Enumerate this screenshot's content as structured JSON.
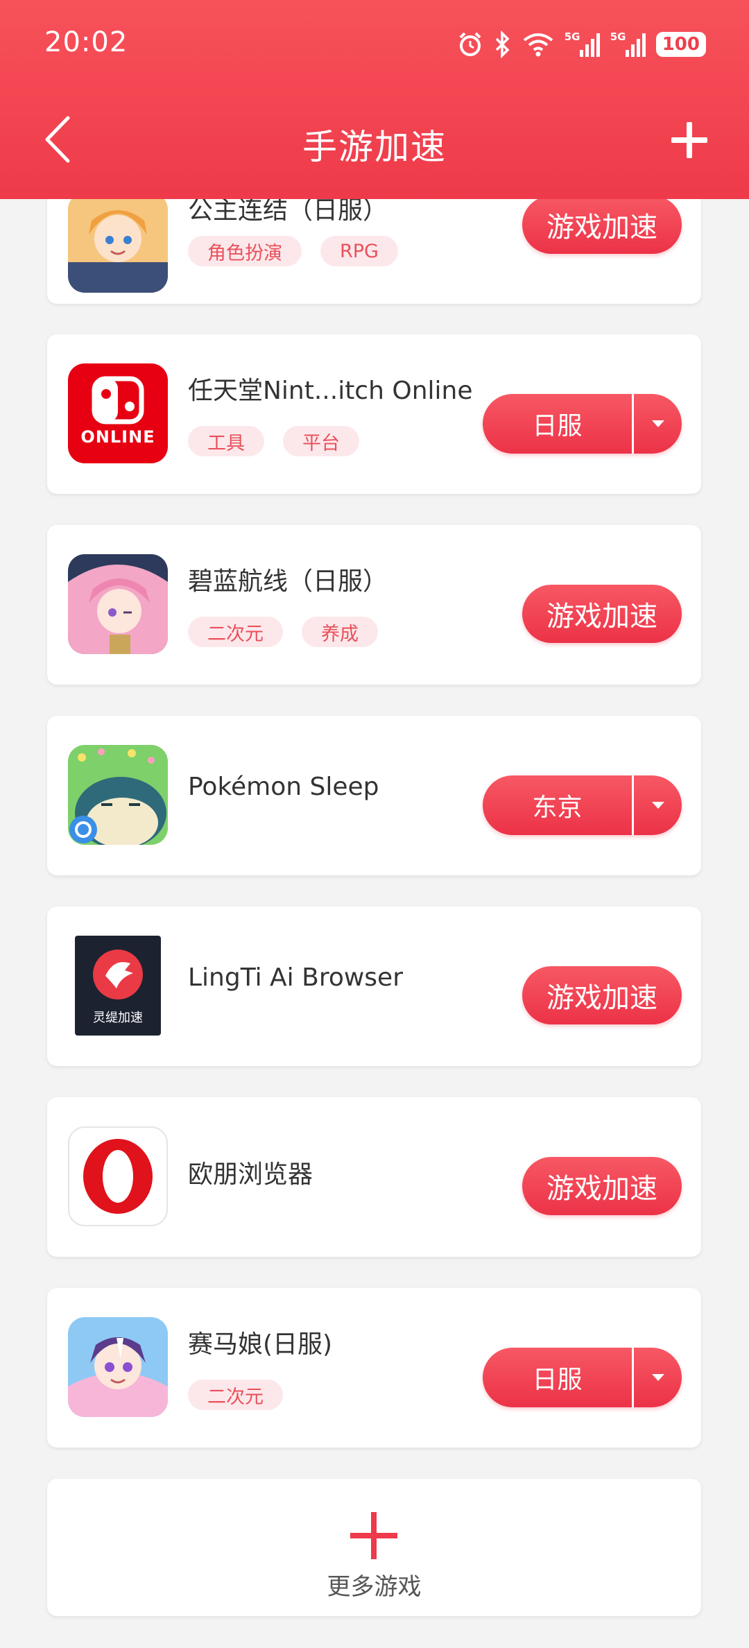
{
  "status_bar": {
    "time": "20:02",
    "icons": [
      "alarm-icon",
      "bluetooth-icon",
      "wifi-icon",
      "signal-5g-icon",
      "signal-5g-icon"
    ],
    "network_label_1": "5G",
    "network_label_2": "5G",
    "battery": "100"
  },
  "nav": {
    "title": "手游加速",
    "back_icon": "chevron-left-icon",
    "add_icon": "plus-icon"
  },
  "colors": {
    "accent": "#ee3a4a",
    "tag_bg": "#fce8ea",
    "tag_text": "#e9505c",
    "background": "#f3f3f3"
  },
  "games": [
    {
      "name": "公主连结（日服）",
      "tags": [
        "角色扮演",
        "RPG"
      ],
      "action": "游戏加速"
    },
    {
      "name": "任天堂Nint...itch Online",
      "tags": [
        "工具",
        "平台"
      ],
      "region": "日服",
      "icon_text": "ONLINE"
    },
    {
      "name": "碧蓝航线（日服）",
      "tags": [
        "二次元",
        "养成"
      ],
      "action": "游戏加速"
    },
    {
      "name": "Pokémon Sleep",
      "tags": [],
      "region": "东京"
    },
    {
      "name": "LingTi Ai Browser",
      "tags": [],
      "action": "游戏加速",
      "icon_text": "灵缇加速"
    },
    {
      "name": "欧朋浏览器",
      "tags": [],
      "action": "游戏加速"
    },
    {
      "name": "赛马娘(日服)",
      "tags": [
        "二次元"
      ],
      "region": "日服"
    }
  ],
  "more_games": {
    "label": "更多游戏",
    "icon": "plus-icon"
  }
}
